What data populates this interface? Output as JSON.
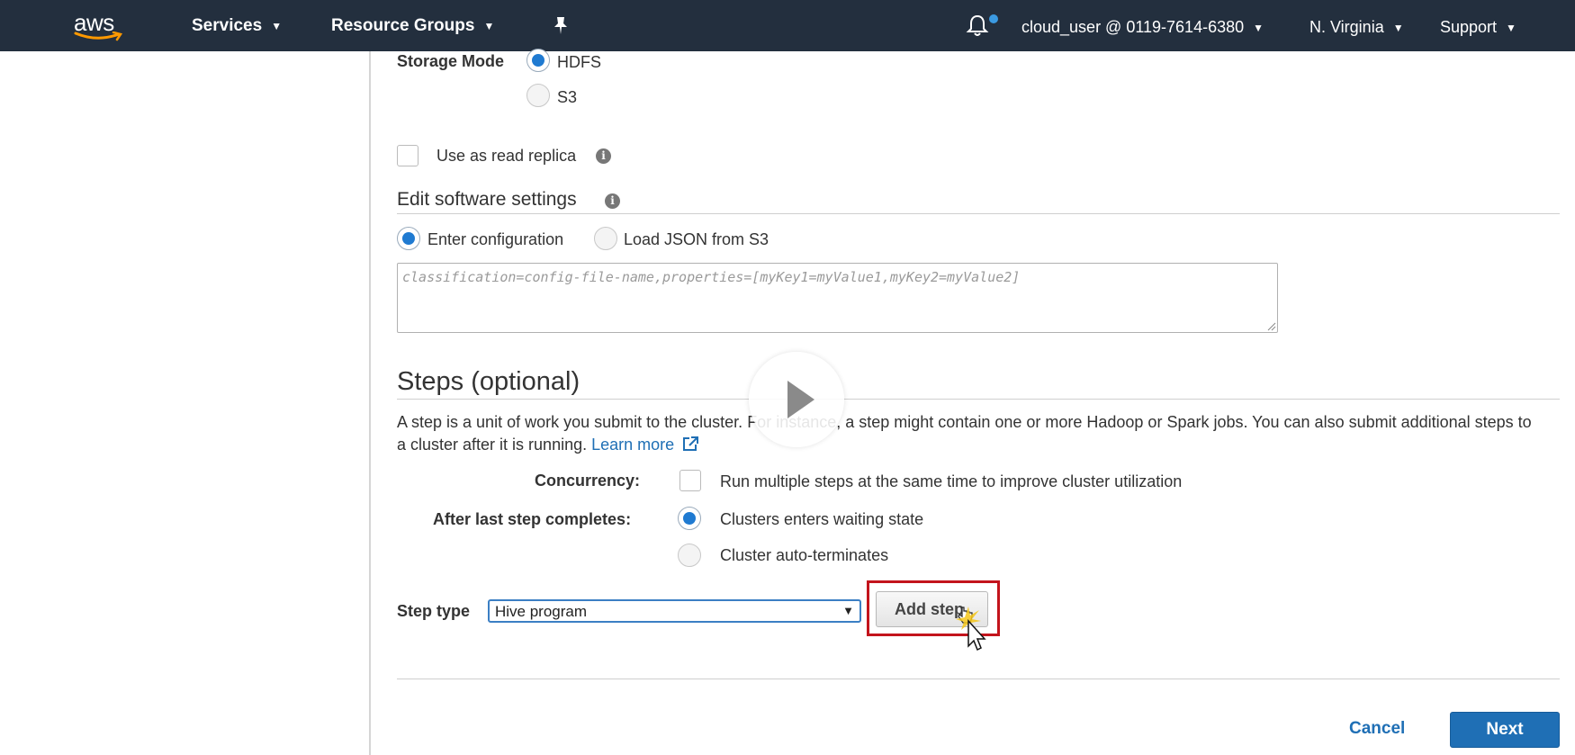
{
  "nav": {
    "logo_text": "aws",
    "services": "Services",
    "resource_groups": "Resource Groups",
    "account": "cloud_user @ 0119-7614-6380",
    "region": "N. Virginia",
    "support": "Support",
    "chevron": "⌄"
  },
  "storage": {
    "label": "Storage Mode",
    "options": [
      "HDFS",
      "S3"
    ],
    "selected": "HDFS"
  },
  "read_replica": {
    "label": "Use as read replica",
    "checked": false
  },
  "software_settings": {
    "title": "Edit software settings",
    "options": [
      "Enter configuration",
      "Load JSON from S3"
    ],
    "selected": "Enter configuration",
    "config_placeholder": "classification=config-file-name,properties=[myKey1=myValue1,myKey2=myValue2]",
    "config_value": ""
  },
  "steps": {
    "title": "Steps (optional)",
    "description": "A step is a unit of work you submit to the cluster. For instance, a step might contain one or more Hadoop or Spark jobs. You can also submit additional steps to a cluster after it is running.",
    "learn_more": "Learn more",
    "concurrency_label": "Concurrency:",
    "concurrency_option": "Run multiple steps at the same time to improve cluster utilization",
    "concurrency_checked": false,
    "after_last_label": "After last step completes:",
    "after_last_options": [
      "Clusters enters waiting state",
      "Cluster auto-terminates"
    ],
    "after_last_selected": "Clusters enters waiting state",
    "step_type_label": "Step type",
    "step_type_value": "Hive program",
    "add_step": "Add step"
  },
  "footer": {
    "cancel": "Cancel",
    "next": "Next"
  },
  "colors": {
    "nav_bg": "#232f3e",
    "accent": "#1f7ad1",
    "link": "#1f6fb5",
    "highlight": "#c3141c"
  }
}
